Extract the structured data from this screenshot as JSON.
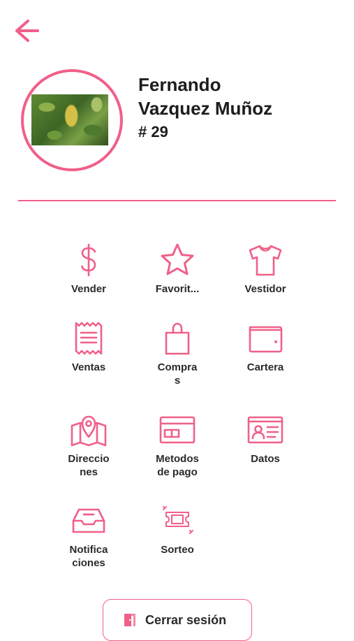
{
  "header": {
    "back_icon": "arrow-left-icon"
  },
  "profile": {
    "name_line1": "Fernando",
    "name_line2": "Vazquez Muñoz",
    "number": "# 29"
  },
  "menu": {
    "vender": "Vender",
    "favoritos": "Favorit...",
    "vestidor": "Vestidor",
    "ventas": "Ventas",
    "compras_1": "Compra",
    "compras_2": "s",
    "cartera": "Cartera",
    "direcciones_1": "Direccio",
    "direcciones_2": "nes",
    "metodos_1": "Metodos",
    "metodos_2": "de pago",
    "datos": "Datos",
    "notificaciones_1": "Notifica",
    "notificaciones_2": "ciones",
    "sorteo": "Sorteo"
  },
  "logout": {
    "label": "Cerrar sesión",
    "icon": "door-exit-icon"
  },
  "colors": {
    "accent": "#f06088",
    "text": "#1c1c1e"
  }
}
